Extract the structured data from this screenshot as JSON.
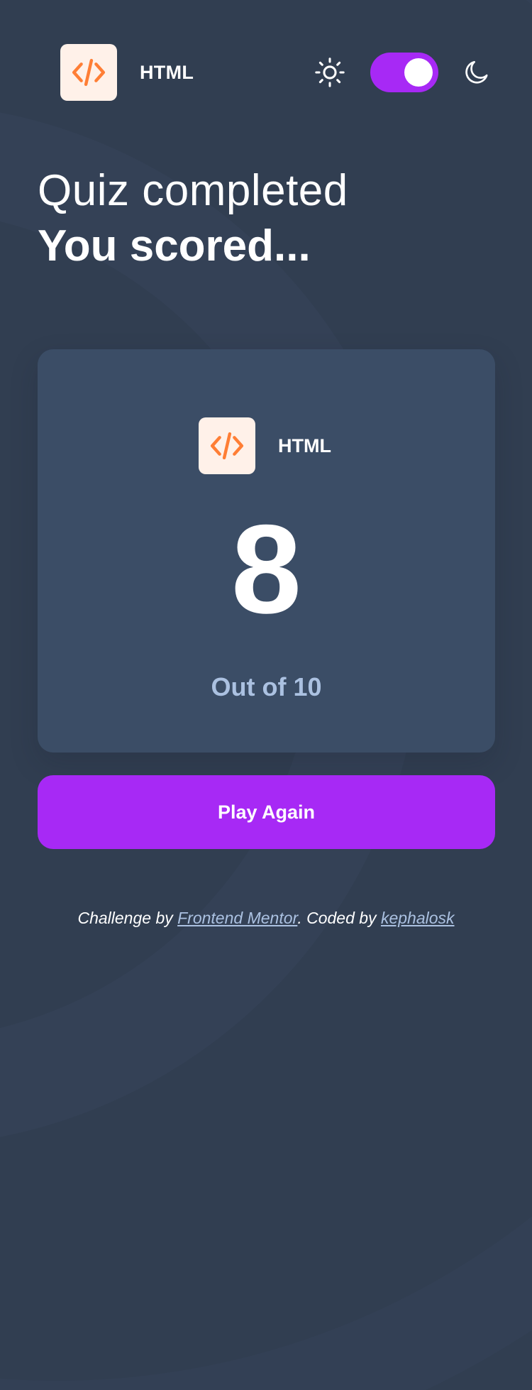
{
  "header": {
    "subject_label": "HTML",
    "subject_icon": "code-icon",
    "theme": {
      "sun_icon": "sun-icon",
      "moon_icon": "moon-icon",
      "dark_mode_on": true
    }
  },
  "heading": {
    "line1": "Quiz completed",
    "line2": "You scored..."
  },
  "score_card": {
    "subject_label": "HTML",
    "subject_icon": "code-icon",
    "score": "8",
    "total_text": "Out of 10"
  },
  "actions": {
    "play_again_label": "Play Again"
  },
  "footer": {
    "prefix": "Challenge by ",
    "mentor_link": "Frontend Mentor",
    "middle": ". Coded by ",
    "author_link": "kephalosk"
  },
  "colors": {
    "background": "#313e51",
    "card": "#3b4d66",
    "accent": "#a729f5",
    "muted_text": "#abc1e1",
    "html_icon_bg": "#fff1e9",
    "html_icon_fg": "#ff7e35"
  }
}
